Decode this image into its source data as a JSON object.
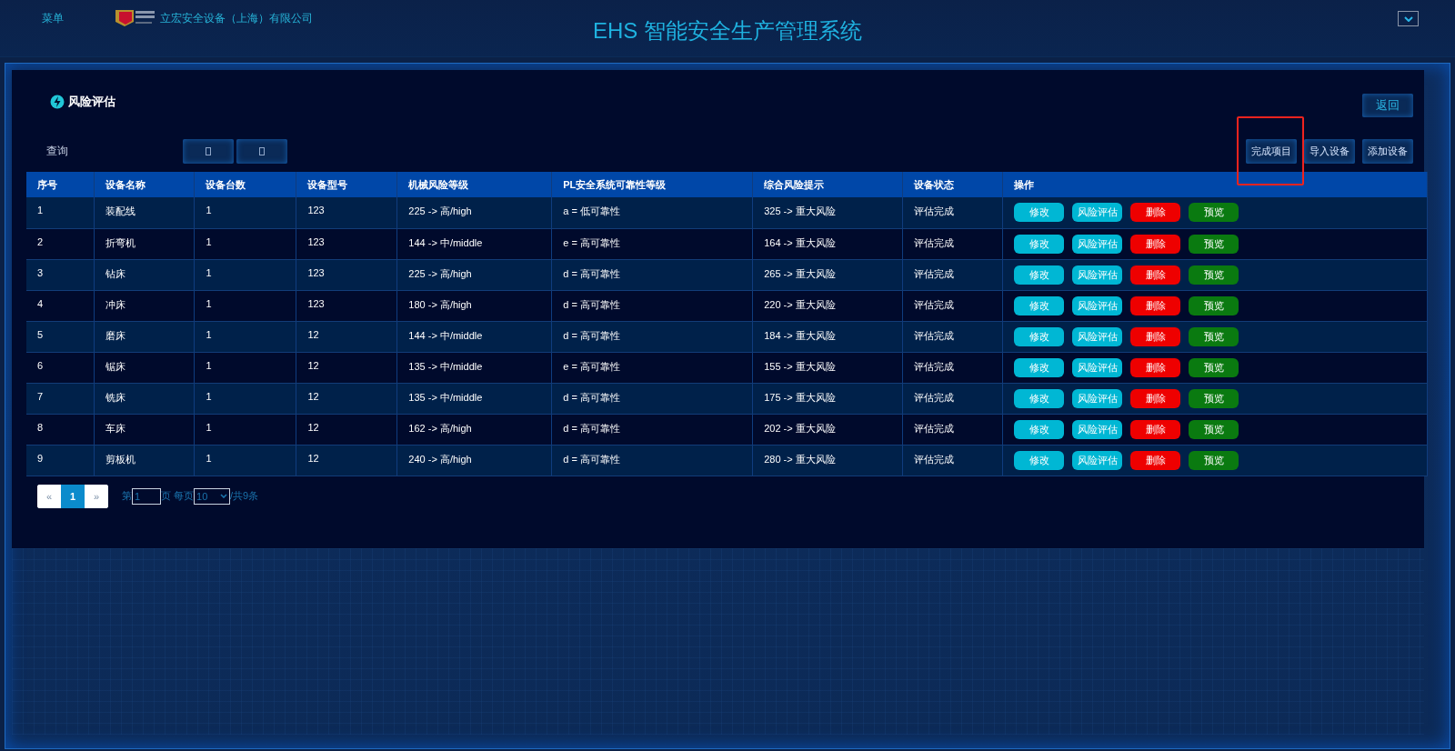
{
  "header": {
    "menu": "菜单",
    "company": "立宏安全设备（上海）有限公司",
    "title": "EHS 智能安全生产管理系统"
  },
  "panel": {
    "title": "风险评估",
    "back": "返回",
    "query_label": "查询",
    "toolbar_buttons": [
      {
        "label": "完成项目",
        "highlighted": true
      },
      {
        "label": "导入设备",
        "highlighted": false
      },
      {
        "label": "添加设备",
        "highlighted": false
      }
    ]
  },
  "table": {
    "columns": [
      "序号",
      "设备名称",
      "设备台数",
      "设备型号",
      "机械风险等级",
      "PL安全系统可靠性等级",
      "综合风险提示",
      "设备状态",
      "操作"
    ],
    "rows": [
      {
        "cells": [
          "1",
          "装配线",
          "1",
          "123",
          "225 -> 高/high",
          "a = 低可靠性",
          "325 -> 重大风险",
          "评估完成"
        ],
        "actions": [
          {
            "label": "修改",
            "kind": "edit"
          },
          {
            "label": "风险评估",
            "kind": "assess"
          },
          {
            "label": "删除",
            "kind": "delete"
          },
          {
            "label": "预览",
            "kind": "preview"
          }
        ]
      },
      {
        "cells": [
          "2",
          "折弯机",
          "1",
          "123",
          "144 -> 中/middle",
          "e = 高可靠性",
          "164 -> 重大风险",
          "评估完成"
        ],
        "actions": [
          {
            "label": "修改",
            "kind": "edit"
          },
          {
            "label": "风险评估",
            "kind": "assess"
          },
          {
            "label": "删除",
            "kind": "delete"
          },
          {
            "label": "预览",
            "kind": "preview"
          }
        ]
      },
      {
        "cells": [
          "3",
          "钻床",
          "1",
          "123",
          "225 -> 高/high",
          "d = 高可靠性",
          "265 -> 重大风险",
          "评估完成"
        ],
        "actions": [
          {
            "label": "修改",
            "kind": "edit"
          },
          {
            "label": "风险评估",
            "kind": "assess"
          },
          {
            "label": "删除",
            "kind": "delete"
          },
          {
            "label": "预览",
            "kind": "preview"
          }
        ]
      },
      {
        "cells": [
          "4",
          "冲床",
          "1",
          "123",
          "180 -> 高/high",
          "d = 高可靠性",
          "220 -> 重大风险",
          "评估完成"
        ],
        "actions": [
          {
            "label": "修改",
            "kind": "edit"
          },
          {
            "label": "风险评估",
            "kind": "assess"
          },
          {
            "label": "删除",
            "kind": "delete"
          },
          {
            "label": "预览",
            "kind": "preview"
          }
        ]
      },
      {
        "cells": [
          "5",
          "磨床",
          "1",
          "12",
          "144 -> 中/middle",
          "d = 高可靠性",
          "184 -> 重大风险",
          "评估完成"
        ],
        "actions": [
          {
            "label": "修改",
            "kind": "edit"
          },
          {
            "label": "风险评估",
            "kind": "assess"
          },
          {
            "label": "删除",
            "kind": "delete"
          },
          {
            "label": "预览",
            "kind": "preview"
          }
        ]
      },
      {
        "cells": [
          "6",
          "锯床",
          "1",
          "12",
          "135 -> 中/middle",
          "e = 高可靠性",
          "155 -> 重大风险",
          "评估完成"
        ],
        "actions": [
          {
            "label": "修改",
            "kind": "edit"
          },
          {
            "label": "风险评估",
            "kind": "assess"
          },
          {
            "label": "删除",
            "kind": "delete"
          },
          {
            "label": "预览",
            "kind": "preview"
          }
        ]
      },
      {
        "cells": [
          "7",
          "铣床",
          "1",
          "12",
          "135 -> 中/middle",
          "d = 高可靠性",
          "175 -> 重大风险",
          "评估完成"
        ],
        "actions": [
          {
            "label": "修改",
            "kind": "edit"
          },
          {
            "label": "风险评估",
            "kind": "assess"
          },
          {
            "label": "删除",
            "kind": "delete"
          },
          {
            "label": "预览",
            "kind": "preview"
          }
        ]
      },
      {
        "cells": [
          "8",
          "车床",
          "1",
          "12",
          "162 -> 高/high",
          "d = 高可靠性",
          "202 -> 重大风险",
          "评估完成"
        ],
        "actions": [
          {
            "label": "修改",
            "kind": "edit"
          },
          {
            "label": "风险评估",
            "kind": "assess"
          },
          {
            "label": "删除",
            "kind": "delete"
          },
          {
            "label": "预览",
            "kind": "preview"
          }
        ]
      },
      {
        "cells": [
          "9",
          "剪板机",
          "1",
          "12",
          "240 -> 高/high",
          "d = 高可靠性",
          "280 -> 重大风险",
          "评估完成"
        ],
        "actions": [
          {
            "label": "修改",
            "kind": "edit"
          },
          {
            "label": "风险评估",
            "kind": "assess"
          },
          {
            "label": "删除",
            "kind": "delete"
          },
          {
            "label": "预览",
            "kind": "preview"
          }
        ]
      }
    ]
  },
  "pagination": {
    "pages": [
      {
        "label": "«",
        "selected": false
      },
      {
        "label": "1",
        "selected": true
      },
      {
        "label": "»",
        "selected": false
      }
    ],
    "prefix": "第",
    "page_value": "1",
    "middle": "页 每页",
    "page_size": "10",
    "total": "/共9条"
  }
}
